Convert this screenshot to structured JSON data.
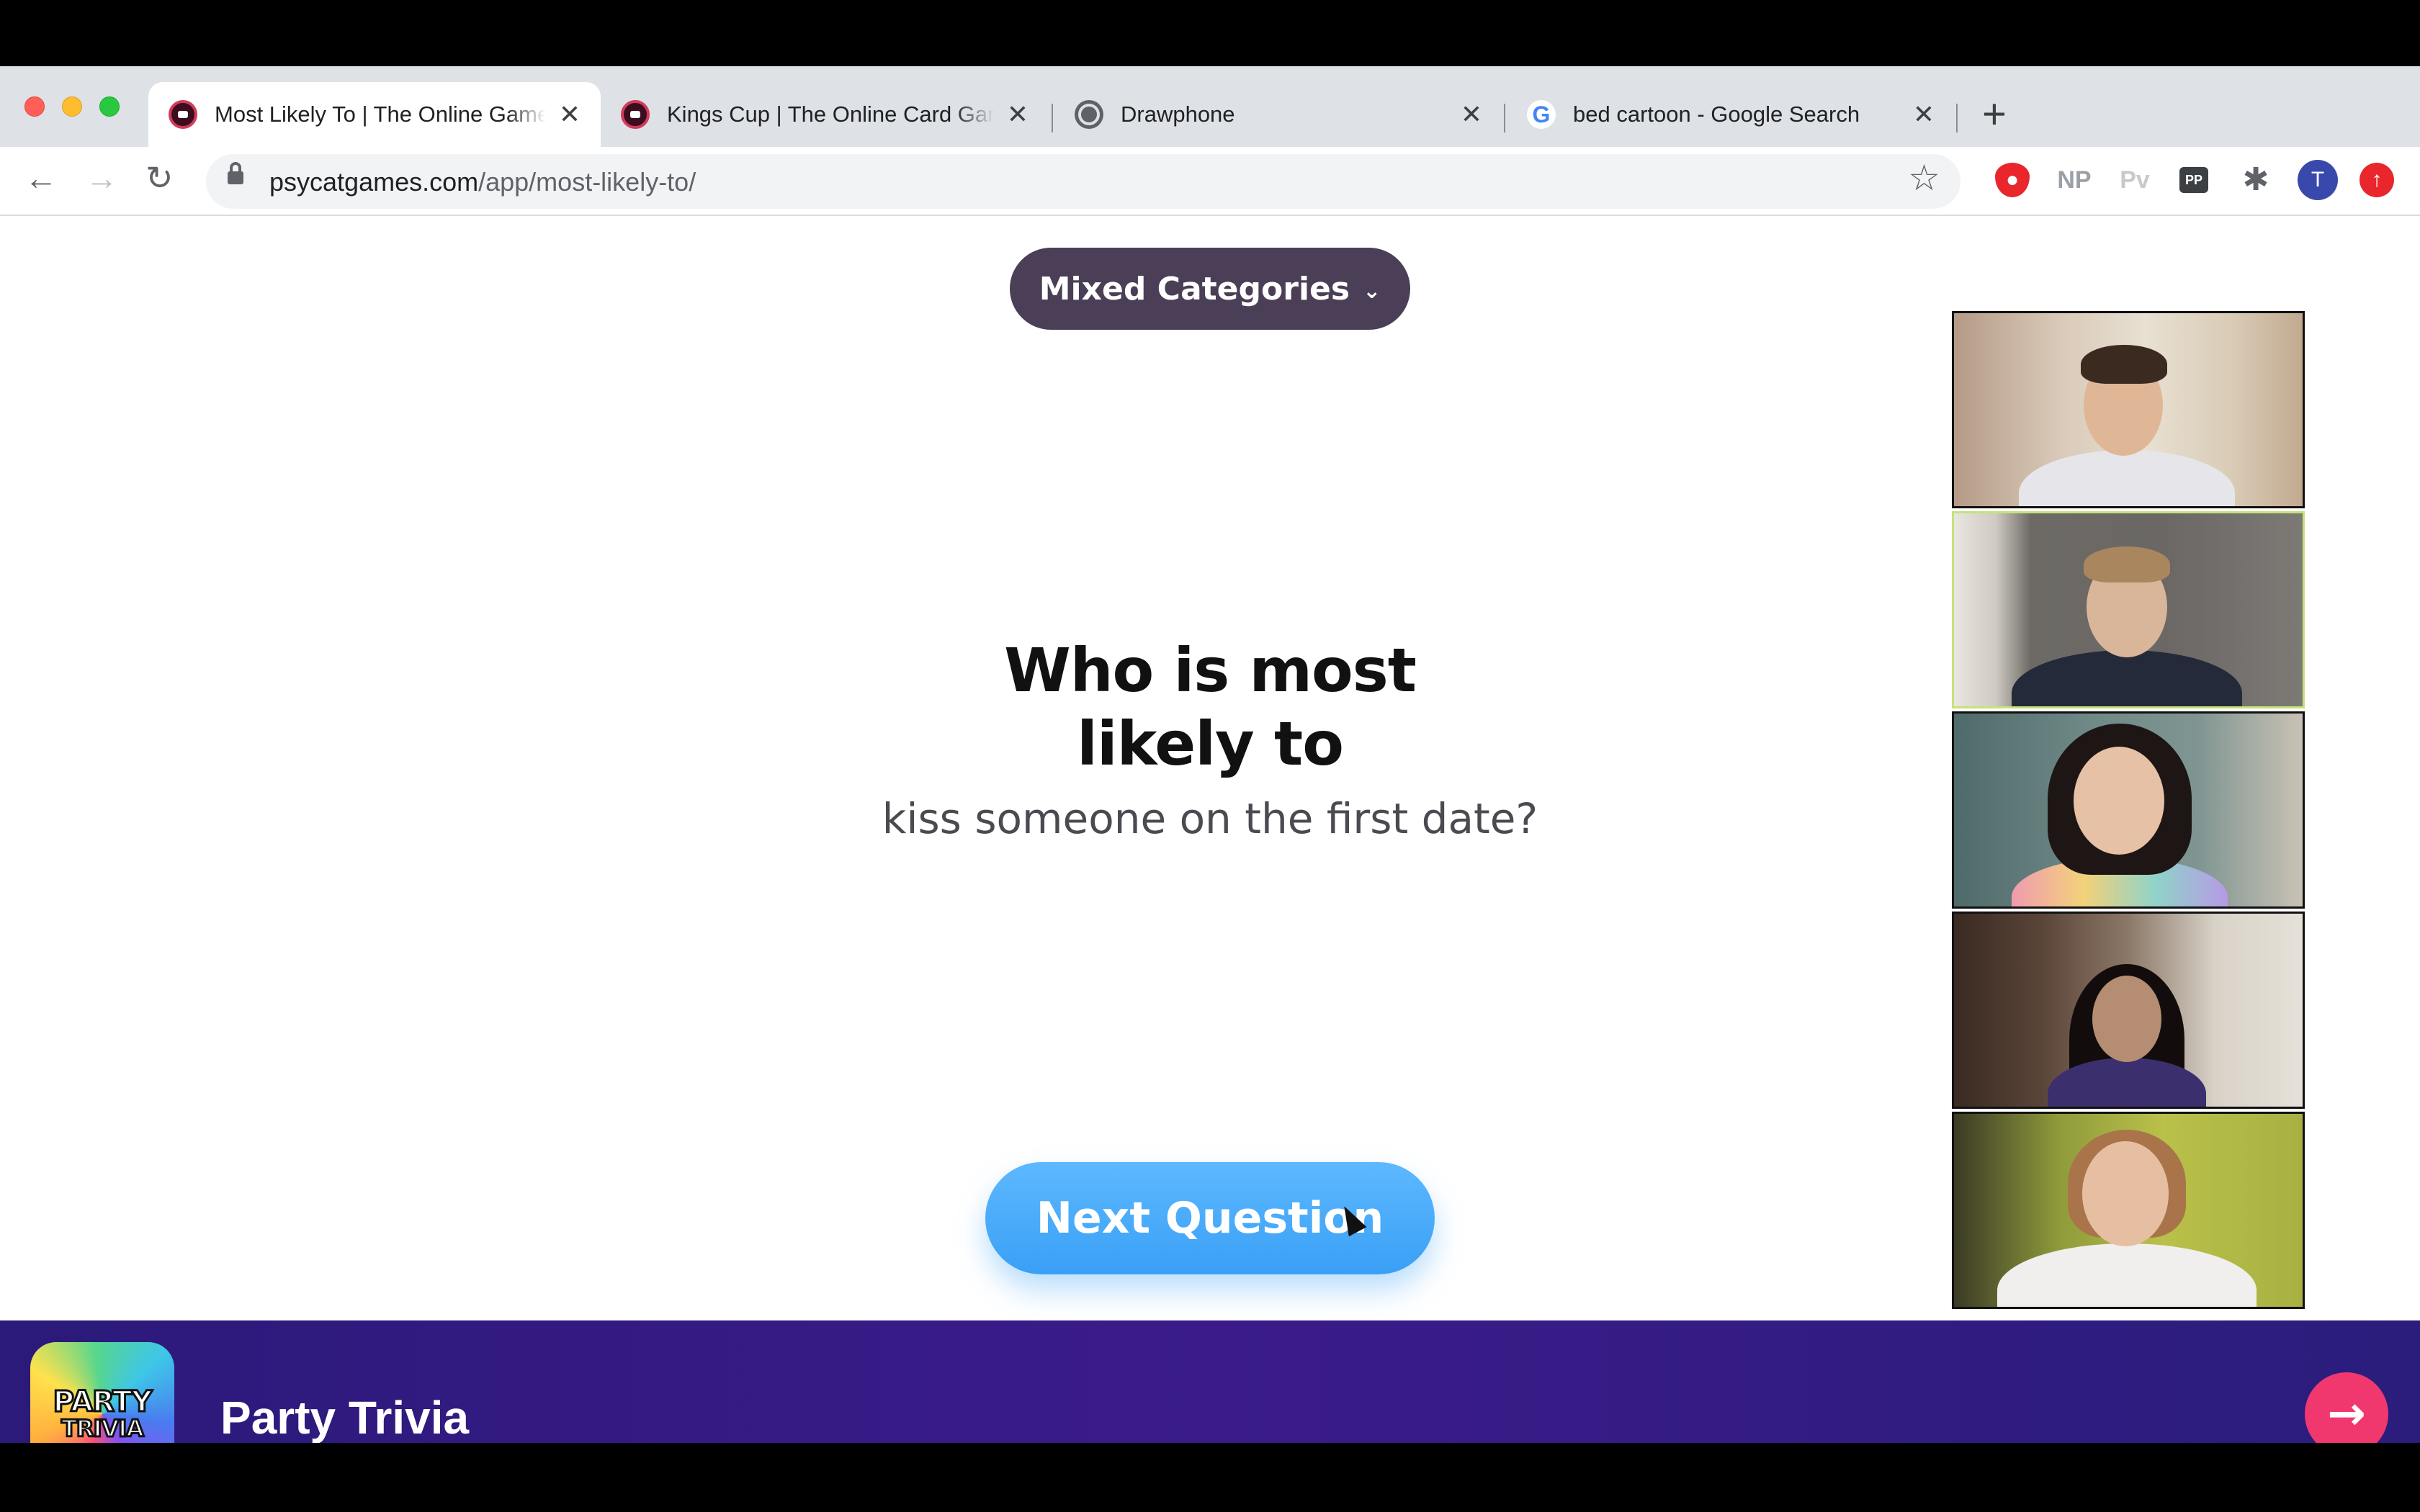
{
  "browser": {
    "tabs": [
      {
        "title": "Most Likely To | The Online Game",
        "active": true,
        "favicon": "cat-icon"
      },
      {
        "title": "Kings Cup | The Online Card Game",
        "active": false,
        "favicon": "cat-icon"
      },
      {
        "title": "Drawphone",
        "active": false,
        "favicon": "globe-icon"
      },
      {
        "title": "bed cartoon - Google Search",
        "active": false,
        "favicon": "google-icon"
      }
    ],
    "close_glyph": "✕",
    "new_tab_glyph": "+",
    "back_glyph": "←",
    "forward_glyph": "→",
    "reload_glyph": "↻",
    "url_domain": "psycatgames.com",
    "url_path": "/app/most-likely-to/",
    "star_glyph": "☆",
    "extensions": {
      "np": "NP",
      "pv": "Pv",
      "pp": "PP",
      "profile_initial": "T"
    }
  },
  "game": {
    "category_label": "Mixed Categories",
    "category_chevron": "⌄",
    "question_line1": "Who is most",
    "question_line2": "likely to",
    "question_body": "kiss someone on the first date?",
    "next_button_label": "Next Question"
  },
  "video_tiles": [
    {
      "name": "participant-1",
      "speaking": false
    },
    {
      "name": "participant-2",
      "speaking": true
    },
    {
      "name": "participant-3",
      "speaking": false
    },
    {
      "name": "participant-4",
      "speaking": false
    },
    {
      "name": "participant-5",
      "speaking": false
    }
  ],
  "ad": {
    "logo_line1": "PARTY",
    "logo_line2": "TRIVIA",
    "title": "Party Trivia",
    "arrow_glyph": "→"
  },
  "colors": {
    "category_button": "#4a3f56",
    "next_button": "#3aa0f5",
    "ad_background": "#2b1a7a",
    "ad_arrow": "#f0386f",
    "speaking_border": "#c6e27a"
  }
}
